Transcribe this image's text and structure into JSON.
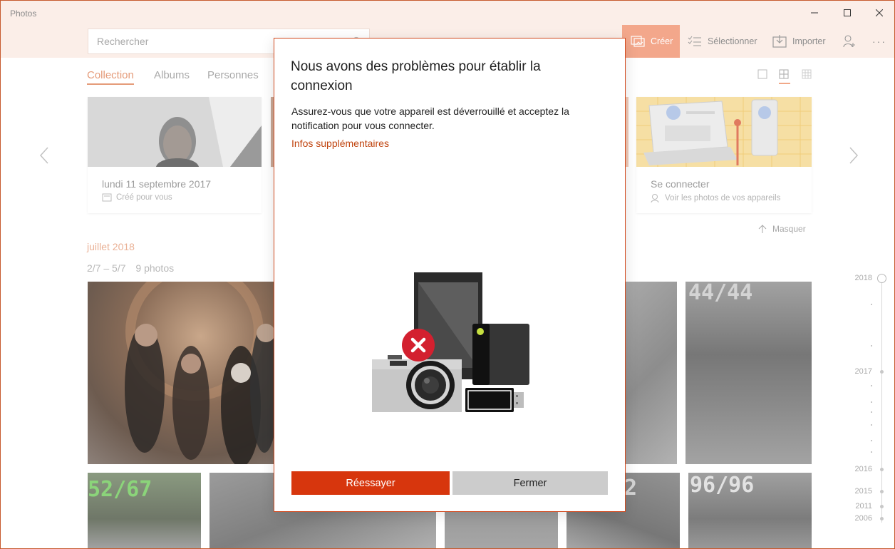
{
  "window": {
    "title": "Photos"
  },
  "search": {
    "placeholder": "Rechercher"
  },
  "toolbar": {
    "create_label": "Créer",
    "select_label": "Sélectionner",
    "import_label": "Importer"
  },
  "tabs": [
    {
      "label": "Collection",
      "active": true
    },
    {
      "label": "Albums"
    },
    {
      "label": "Personnes"
    }
  ],
  "cards": {
    "left": {
      "title": "lundi 11 septembre 2017",
      "subtitle": "Créé pour vous"
    },
    "right": {
      "title": "Se connecter",
      "subtitle": "Voir les photos de vos appareils"
    }
  },
  "hide_label": "Masquer",
  "section": {
    "month": "juillet 2018",
    "date_range": "2/7 – 5/7",
    "count": "9 photos"
  },
  "photo_overlays": {
    "p3": "44/44",
    "p4": "52/67",
    "p7": "2",
    "p8": "96/96"
  },
  "timeline": {
    "years": [
      "2018",
      "2017",
      "2016",
      "2015",
      "2011",
      "2006"
    ]
  },
  "dialog": {
    "title": "Nous avons des problèmes pour établir la connexion",
    "body": "Assurez-vous que votre appareil est déverrouillé et acceptez la notification pour vous connecter.",
    "link": "Infos supplémentaires",
    "retry_label": "Réessayer",
    "close_label": "Fermer"
  },
  "colors": {
    "accent": "#d7360d",
    "link": "#c0440f",
    "create_bg": "#f3a78b",
    "error_red": "#d3202f"
  }
}
